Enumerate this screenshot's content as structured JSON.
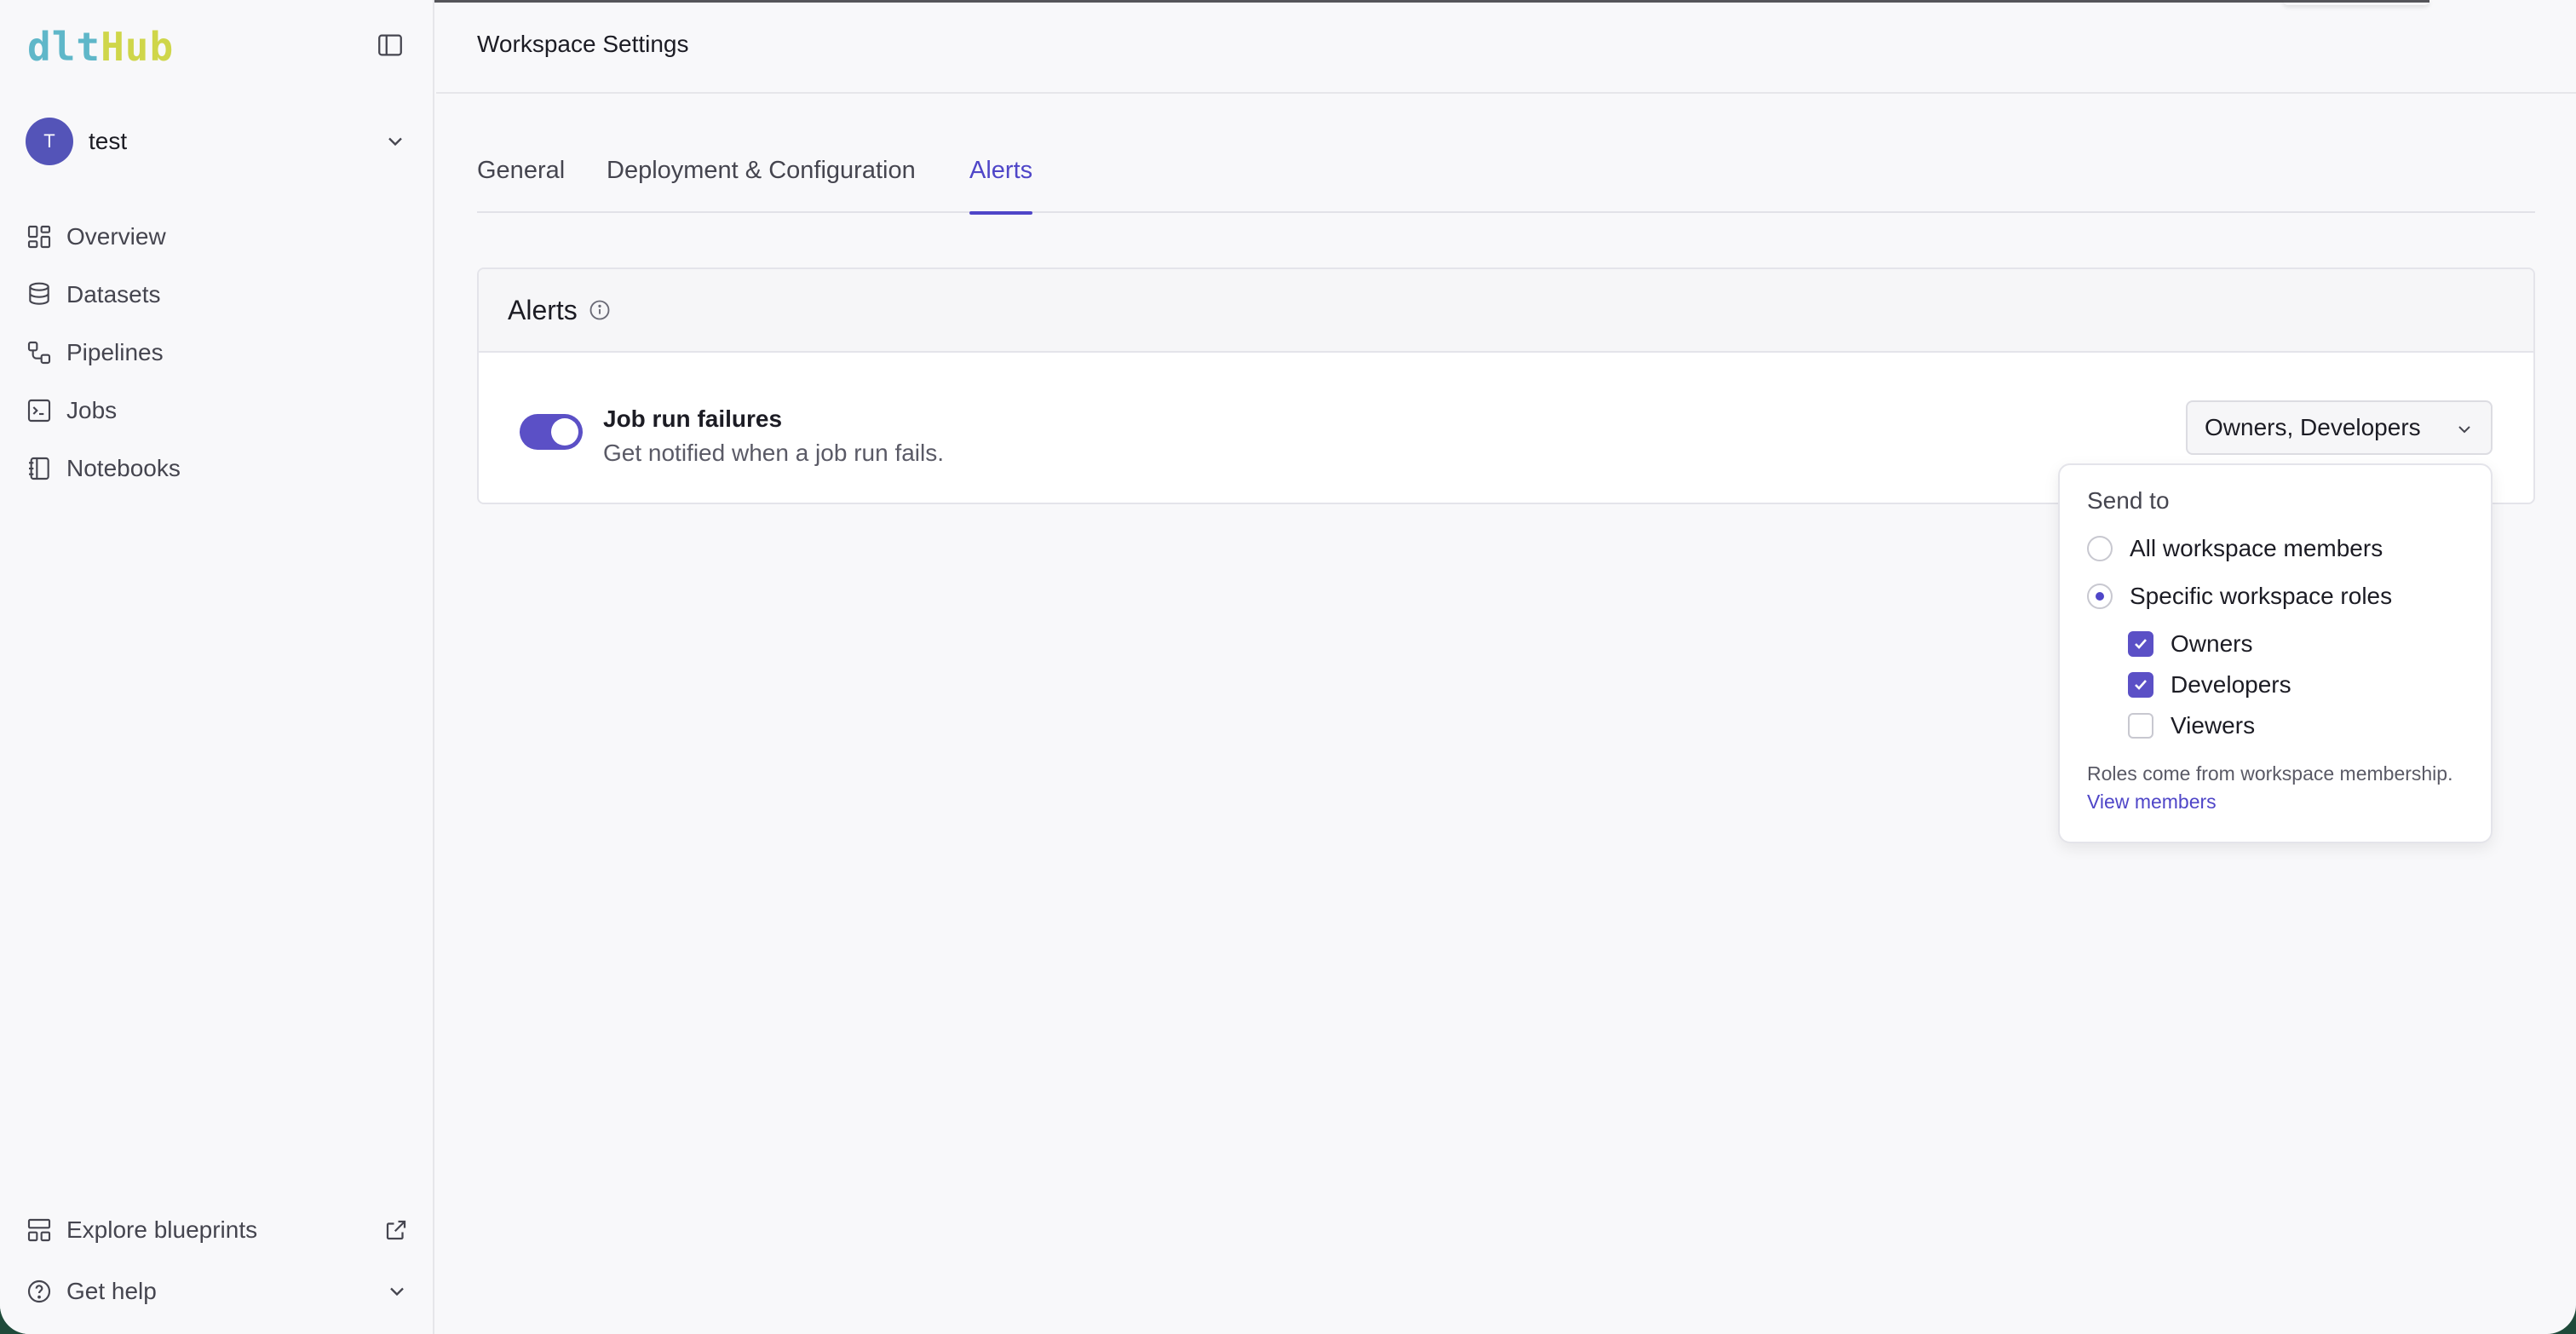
{
  "logo": {
    "part1": "dlt",
    "part2": "Hub"
  },
  "workspace": {
    "initial": "T",
    "name": "test"
  },
  "sidebar": {
    "items": [
      {
        "label": "Overview",
        "icon": "overview-icon"
      },
      {
        "label": "Datasets",
        "icon": "database-icon"
      },
      {
        "label": "Pipelines",
        "icon": "pipeline-icon"
      },
      {
        "label": "Jobs",
        "icon": "terminal-icon"
      },
      {
        "label": "Notebooks",
        "icon": "notebook-icon"
      }
    ],
    "explore_label": "Explore blueprints",
    "help_label": "Get help"
  },
  "header": {
    "title": "Workspace Settings"
  },
  "tabs": [
    {
      "label": "General",
      "active": false
    },
    {
      "label": "Deployment & Configuration",
      "active": false
    },
    {
      "label": "Alerts",
      "active": true
    }
  ],
  "alerts_card": {
    "title": "Alerts",
    "row": {
      "title": "Job run failures",
      "description": "Get notified when a job run fails.",
      "enabled": true,
      "select_value": "Owners, Developers"
    }
  },
  "popover": {
    "label": "Send to",
    "options": [
      {
        "label": "All workspace members",
        "selected": false
      },
      {
        "label": "Specific workspace roles",
        "selected": true
      }
    ],
    "roles": [
      {
        "label": "Owners",
        "checked": true
      },
      {
        "label": "Developers",
        "checked": true
      },
      {
        "label": "Viewers",
        "checked": false
      }
    ],
    "footer_text": "Roles come from workspace membership.",
    "footer_link": "View members"
  },
  "colors": {
    "accent": "#4f46c8",
    "toggle": "#5b50c6",
    "logo_dlt": "#5fb7c9",
    "logo_hub": "#cfd64a"
  }
}
